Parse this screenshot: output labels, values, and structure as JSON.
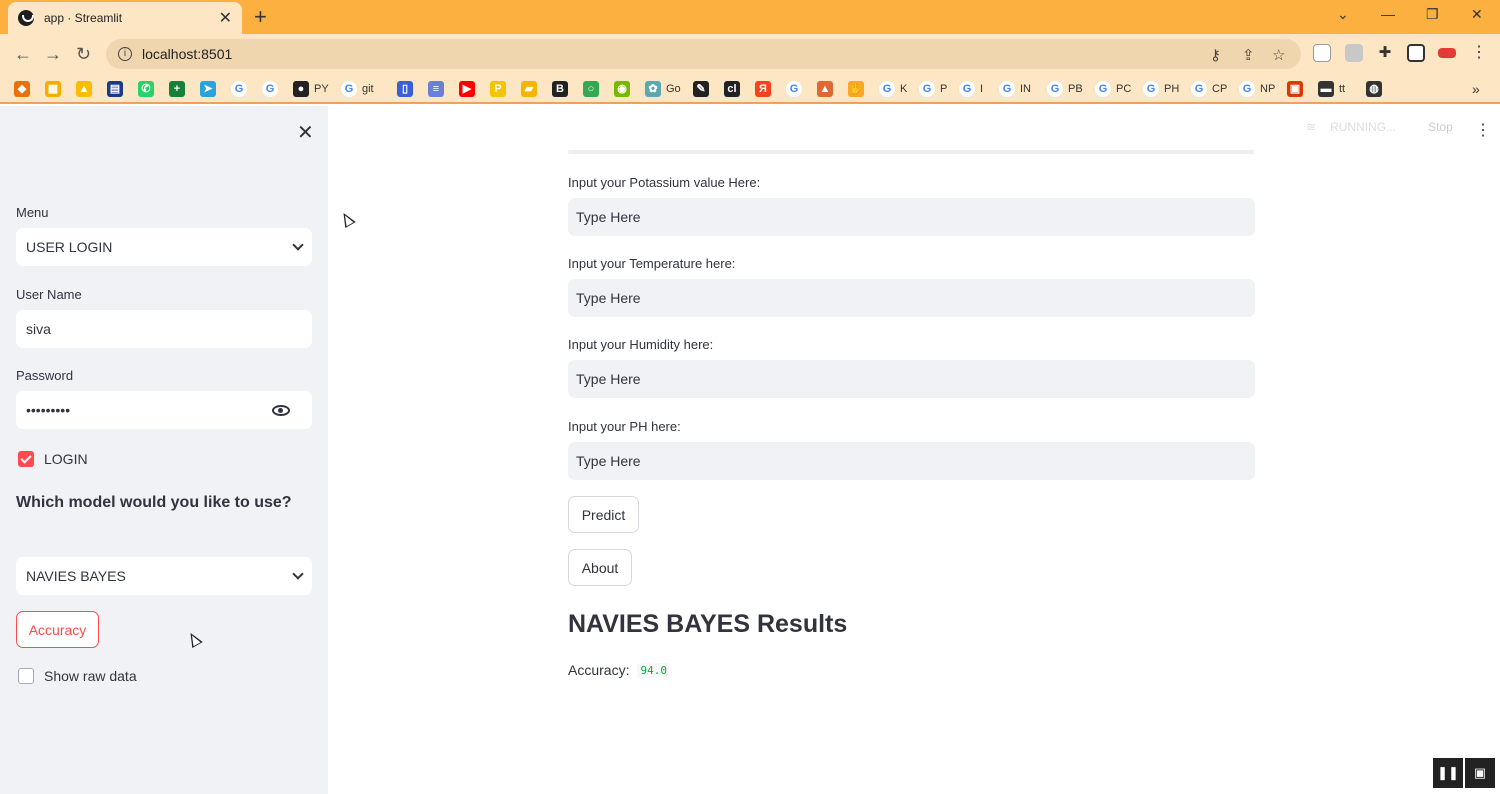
{
  "browser": {
    "tab_title": "app · Streamlit",
    "tab_close": "✕",
    "new_tab": "+",
    "url": "localhost:8501",
    "info_glyph": "i",
    "window_controls": [
      "⌄",
      "—",
      "❐",
      "✕"
    ],
    "bookmarks": [
      {
        "label": "",
        "icon": "arrow-icon",
        "color": "#e8710a",
        "glyph": "◆"
      },
      {
        "label": "",
        "icon": "package-icon",
        "color": "#f9ab00",
        "glyph": "▦"
      },
      {
        "label": "",
        "icon": "chart-icon",
        "color": "#fbbc04",
        "glyph": "▲"
      },
      {
        "label": "",
        "icon": "ieee-icon",
        "color": "#1a3a8c",
        "glyph": "▤"
      },
      {
        "label": "",
        "icon": "whatsapp-icon",
        "color": "#25d366",
        "glyph": "✆"
      },
      {
        "label": "",
        "icon": "sheets-icon",
        "color": "#188038",
        "glyph": "+"
      },
      {
        "label": "",
        "icon": "telegram-icon",
        "color": "#2aa3dd",
        "glyph": "➤"
      },
      {
        "label": "",
        "icon": "google-icon",
        "color": "#fff",
        "glyph": "G"
      },
      {
        "label": "",
        "icon": "google-icon",
        "color": "#fff",
        "glyph": "G"
      },
      {
        "label": "PY",
        "icon": "github-icon",
        "color": "#222",
        "glyph": "●"
      },
      {
        "label": "git",
        "icon": "google-icon",
        "color": "#fff",
        "glyph": "G"
      },
      {
        "label": "",
        "icon": "bracket-icon",
        "color": "#3b5fd9",
        "glyph": "▯"
      },
      {
        "label": "",
        "icon": "translate-icon",
        "color": "#6a7fd6",
        "glyph": "≡"
      },
      {
        "label": "",
        "icon": "youtube-icon",
        "color": "#ff0000",
        "glyph": "▶"
      },
      {
        "label": "",
        "icon": "p-icon",
        "color": "#f5c400",
        "glyph": "P"
      },
      {
        "label": "",
        "icon": "folder-icon",
        "color": "#f4b400",
        "glyph": "▰"
      },
      {
        "label": "",
        "icon": "b-icon",
        "color": "#222",
        "glyph": "B"
      },
      {
        "label": "",
        "icon": "ring-icon",
        "color": "#34a853",
        "glyph": "○"
      },
      {
        "label": "",
        "icon": "nvidia-icon",
        "color": "#76b900",
        "glyph": "◉"
      },
      {
        "label": "Go",
        "icon": "leaf-icon",
        "color": "#5aa9b0",
        "glyph": "✿"
      },
      {
        "label": "",
        "icon": "tab-icon",
        "color": "#222",
        "glyph": "✎"
      },
      {
        "label": "",
        "icon": "cl-icon",
        "color": "#222",
        "glyph": "cl"
      },
      {
        "label": "",
        "icon": "yandex-icon",
        "color": "#fc3f1d",
        "glyph": "Я"
      },
      {
        "label": "",
        "icon": "google-icon",
        "color": "#fff",
        "glyph": "G"
      },
      {
        "label": "",
        "icon": "matlab-icon",
        "color": "#e16737",
        "glyph": "▲"
      },
      {
        "label": "",
        "icon": "hand-icon",
        "color": "#f9a825",
        "glyph": "✋"
      },
      {
        "label": "K",
        "icon": "google-icon",
        "color": "#fff",
        "glyph": "G"
      },
      {
        "label": "P",
        "icon": "google-icon",
        "color": "#fff",
        "glyph": "G"
      },
      {
        "label": "I",
        "icon": "google-icon",
        "color": "#fff",
        "glyph": "G"
      },
      {
        "label": "IN",
        "icon": "google-icon",
        "color": "#fff",
        "glyph": "G"
      },
      {
        "label": "PB",
        "icon": "google-icon",
        "color": "#fff",
        "glyph": "G"
      },
      {
        "label": "PC",
        "icon": "google-icon",
        "color": "#fff",
        "glyph": "G"
      },
      {
        "label": "PH",
        "icon": "google-icon",
        "color": "#fff",
        "glyph": "G"
      },
      {
        "label": "CP",
        "icon": "google-icon",
        "color": "#fff",
        "glyph": "G"
      },
      {
        "label": "NP",
        "icon": "google-icon",
        "color": "#fff",
        "glyph": "G"
      },
      {
        "label": "",
        "icon": "office-icon",
        "color": "#d83b01",
        "glyph": "▣"
      },
      {
        "label": "tt",
        "icon": "car-icon",
        "color": "#333",
        "glyph": "▬"
      },
      {
        "label": "",
        "icon": "globe-icon",
        "color": "#333",
        "glyph": "◍"
      }
    ],
    "bookmarks_overflow": "»"
  },
  "sidebar": {
    "close_glyph": "✕",
    "menu_label": "Menu",
    "menu_value": "USER LOGIN",
    "username_label": "User Name",
    "username_value": "siva",
    "password_label": "Password",
    "password_value": "•••••••••",
    "login_label": "LOGIN",
    "login_checked": true,
    "model_heading": "Which model would you like to use?",
    "model_value": "NAVIES BAYES",
    "accuracy_button": "Accuracy",
    "raw_data_label": "Show raw data",
    "raw_data_checked": false,
    "accent_color": "#ff4b4b"
  },
  "main": {
    "top_status": "RUNNING...",
    "stop_label": "Stop",
    "fields": [
      {
        "label": "Input your Potassium value Here:",
        "placeholder": "Type Here"
      },
      {
        "label": "Input your Temperature here:",
        "placeholder": "Type Here"
      },
      {
        "label": "Input your Humidity here:",
        "placeholder": "Type Here"
      },
      {
        "label": "Input your PH here:",
        "placeholder": "Type Here"
      }
    ],
    "predict_button": "Predict",
    "about_button": "About",
    "results_heading": "NAVIES BAYES Results",
    "accuracy_label": "Accuracy:",
    "accuracy_value": "94.0"
  }
}
